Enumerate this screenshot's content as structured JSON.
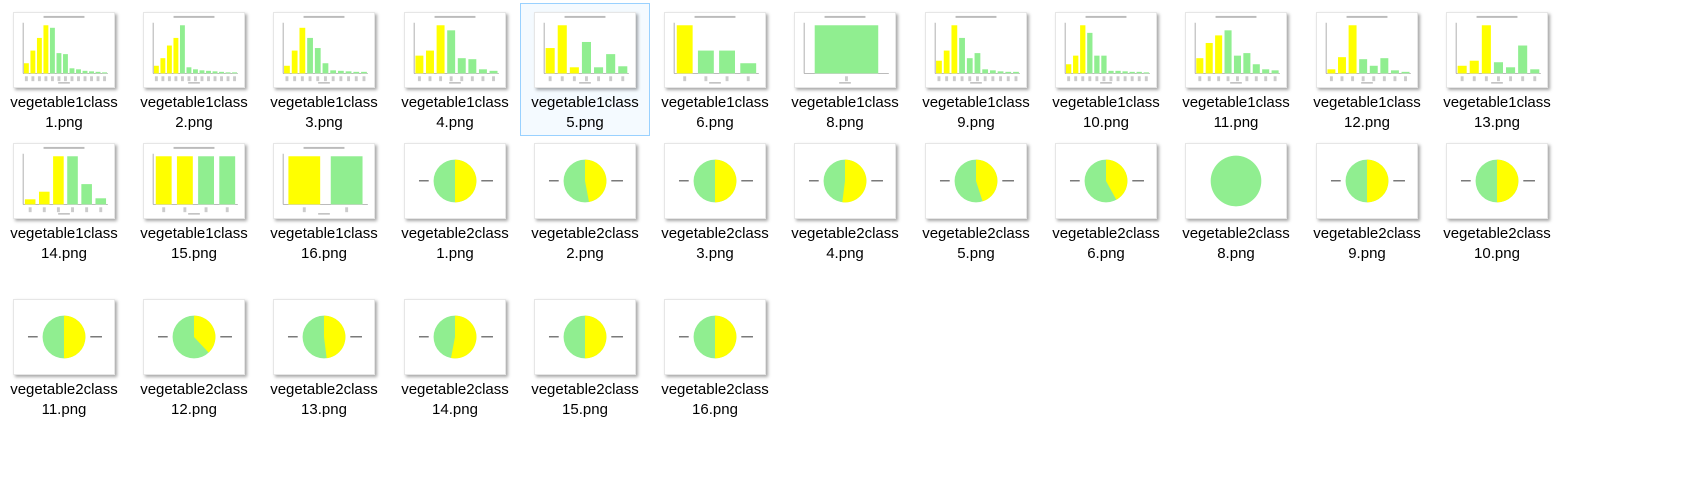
{
  "files": [
    {
      "name": "vegetable1class 1.png",
      "line1": "vegetable1class",
      "line2": "1.png",
      "thumb": "bar",
      "selected": false
    },
    {
      "name": "vegetable1class 2.png",
      "line1": "vegetable1class",
      "line2": "2.png",
      "thumb": "bar",
      "selected": false
    },
    {
      "name": "vegetable1class 3.png",
      "line1": "vegetable1class",
      "line2": "3.png",
      "thumb": "bar",
      "selected": false
    },
    {
      "name": "vegetable1class 4.png",
      "line1": "vegetable1class",
      "line2": "4.png",
      "thumb": "bar",
      "selected": false
    },
    {
      "name": "vegetable1class 5.png",
      "line1": "vegetable1class",
      "line2": "5.png",
      "thumb": "bar",
      "selected": true
    },
    {
      "name": "vegetable1class 6.png",
      "line1": "vegetable1class",
      "line2": "6.png",
      "thumb": "bar",
      "selected": false
    },
    {
      "name": "vegetable1class 8.png",
      "line1": "vegetable1class",
      "line2": "8.png",
      "thumb": "bar",
      "selected": false
    },
    {
      "name": "vegetable1class 9.png",
      "line1": "vegetable1class",
      "line2": "9.png",
      "thumb": "bar",
      "selected": false
    },
    {
      "name": "vegetable1class 10.png",
      "line1": "vegetable1class",
      "line2": "10.png",
      "thumb": "bar",
      "selected": false
    },
    {
      "name": "vegetable1class 11.png",
      "line1": "vegetable1class",
      "line2": "11.png",
      "thumb": "bar",
      "selected": false
    },
    {
      "name": "vegetable1class 12.png",
      "line1": "vegetable1class",
      "line2": "12.png",
      "thumb": "bar",
      "selected": false
    },
    {
      "name": "vegetable1class 13.png",
      "line1": "vegetable1class",
      "line2": "13.png",
      "thumb": "bar",
      "selected": false
    },
    {
      "name": "vegetable1class 14.png",
      "line1": "vegetable1class",
      "line2": "14.png",
      "thumb": "bar",
      "selected": false
    },
    {
      "name": "vegetable1class 15.png",
      "line1": "vegetable1class",
      "line2": "15.png",
      "thumb": "bar",
      "selected": false
    },
    {
      "name": "vegetable1class 16.png",
      "line1": "vegetable1class",
      "line2": "16.png",
      "thumb": "bar",
      "selected": false
    },
    {
      "name": "vegetable2class 1.png",
      "line1": "vegetable2class",
      "line2": "1.png",
      "thumb": "pie",
      "selected": false
    },
    {
      "name": "vegetable2class 2.png",
      "line1": "vegetable2class",
      "line2": "2.png",
      "thumb": "pie",
      "selected": false
    },
    {
      "name": "vegetable2class 3.png",
      "line1": "vegetable2class",
      "line2": "3.png",
      "thumb": "pie",
      "selected": false
    },
    {
      "name": "vegetable2class 4.png",
      "line1": "vegetable2class",
      "line2": "4.png",
      "thumb": "pie",
      "selected": false
    },
    {
      "name": "vegetable2class 5.png",
      "line1": "vegetable2class",
      "line2": "5.png",
      "thumb": "pie",
      "selected": false
    },
    {
      "name": "vegetable2class 6.png",
      "line1": "vegetable2class",
      "line2": "6.png",
      "thumb": "pie",
      "selected": false
    },
    {
      "name": "vegetable2class 8.png",
      "line1": "vegetable2class",
      "line2": "8.png",
      "thumb": "pie",
      "selected": false
    },
    {
      "name": "vegetable2class 9.png",
      "line1": "vegetable2class",
      "line2": "9.png",
      "thumb": "pie",
      "selected": false
    },
    {
      "name": "vegetable2class 10.png",
      "line1": "vegetable2class",
      "line2": "10.png",
      "thumb": "pie",
      "selected": false
    },
    {
      "name": "vegetable2class 11.png",
      "line1": "vegetable2class",
      "line2": "11.png",
      "thumb": "pie",
      "selected": false
    },
    {
      "name": "vegetable2class 12.png",
      "line1": "vegetable2class",
      "line2": "12.png",
      "thumb": "pie",
      "selected": false
    },
    {
      "name": "vegetable2class 13.png",
      "line1": "vegetable2class",
      "line2": "13.png",
      "thumb": "pie",
      "selected": false
    },
    {
      "name": "vegetable2class 14.png",
      "line1": "vegetable2class",
      "line2": "14.png",
      "thumb": "pie",
      "selected": false
    },
    {
      "name": "vegetable2class 15.png",
      "line1": "vegetable2class",
      "line2": "15.png",
      "thumb": "pie",
      "selected": false
    },
    {
      "name": "vegetable2class 16.png",
      "line1": "vegetable2class",
      "line2": "16.png",
      "thumb": "pie",
      "selected": false
    }
  ],
  "colors": {
    "yellow": "#ffff00",
    "green": "#90ee90",
    "selection_border": "#99d1ff"
  }
}
